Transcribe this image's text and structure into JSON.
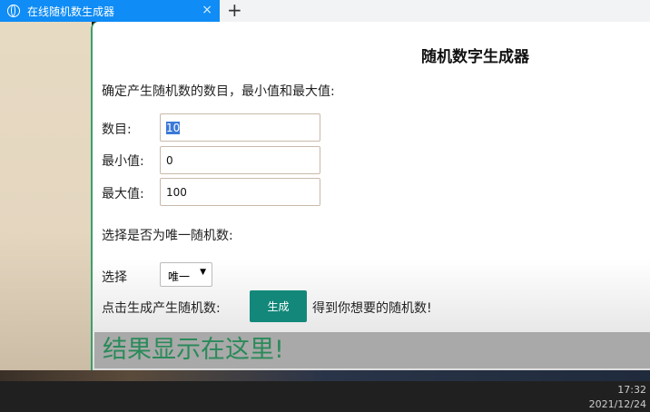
{
  "browser": {
    "tab_title": "在线随机数生成器",
    "tab_icon": "globe-icon",
    "close_label": "×",
    "new_tab_label": "+"
  },
  "page": {
    "title": "随机数字生成器",
    "intro": "确定产生随机数的数目，最小值和最大值:",
    "fields": [
      {
        "label": "数目:",
        "value": "10"
      },
      {
        "label": "最小值:",
        "value": "0"
      },
      {
        "label": "最大值:",
        "value": "100"
      }
    ],
    "unique_prompt": "选择是否为唯一随机数:",
    "select_label": "选择",
    "select_value": "唯一",
    "generate_prompt": "点击生成产生随机数:",
    "generate_button": "生成",
    "generate_suffix": "得到你想要的随机数!",
    "result": "结果显示在这里!",
    "accent": "#13887a"
  },
  "taskbar": {
    "time": "17:32",
    "date": "2021/12/24"
  }
}
